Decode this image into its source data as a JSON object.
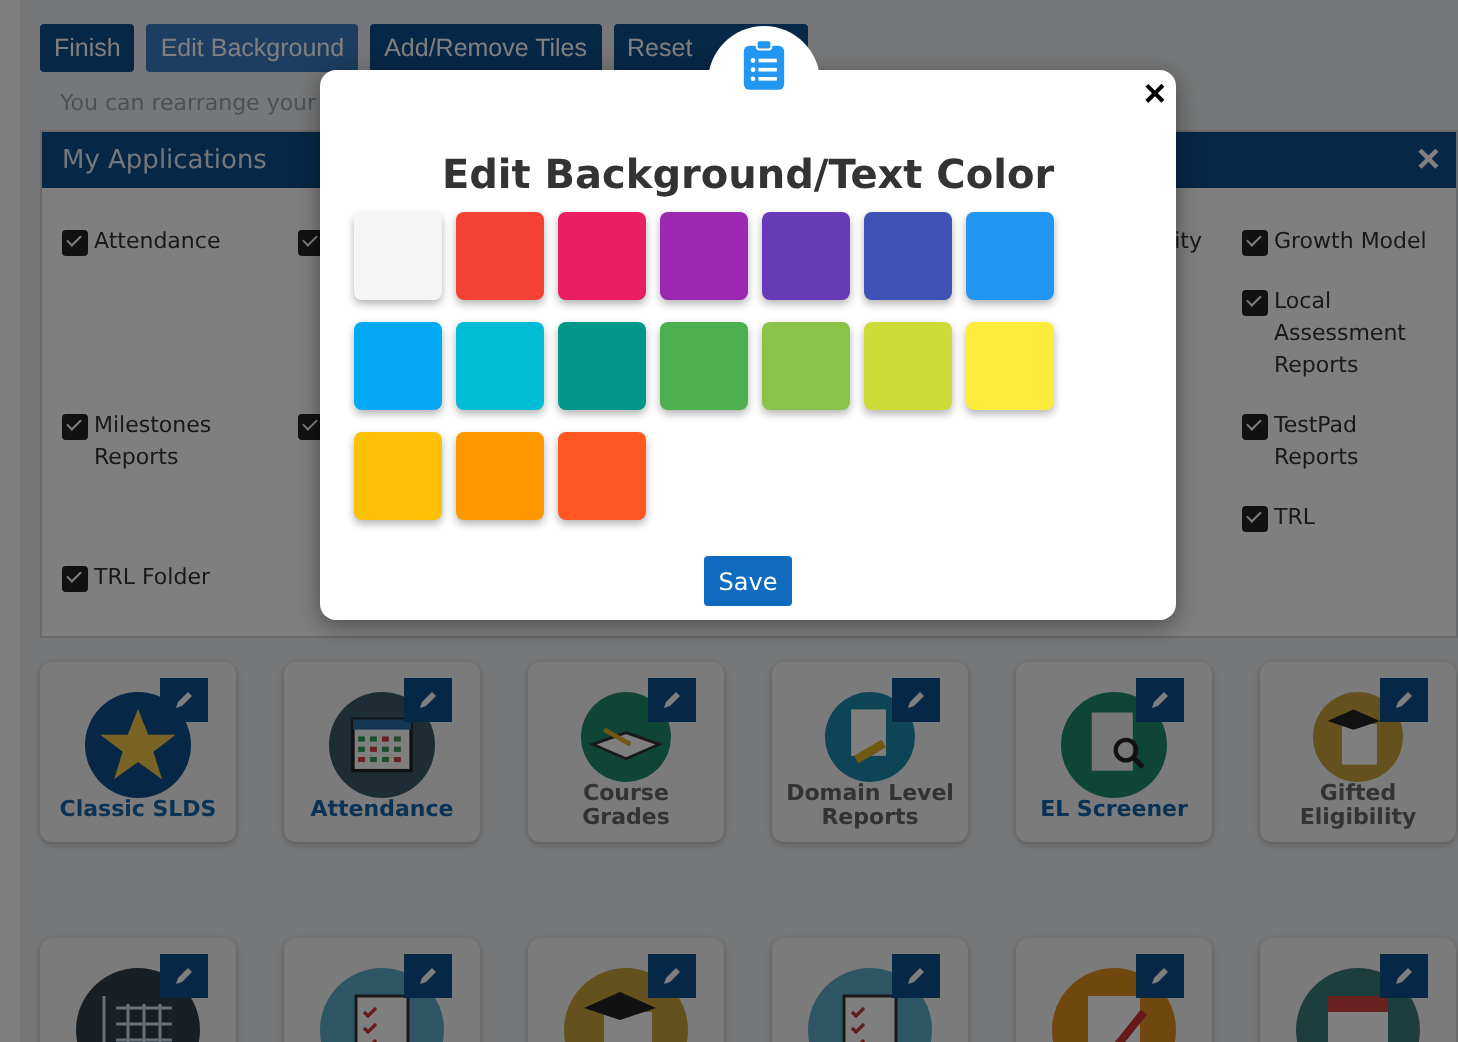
{
  "toolbar": [
    {
      "label": "Finish",
      "selected": false
    },
    {
      "label": "Edit Background",
      "selected": true
    },
    {
      "label": "Add/Remove Tiles",
      "selected": false
    },
    {
      "label": "Reset",
      "selected": false
    }
  ],
  "hint": "You can rearrange your",
  "panel": {
    "title": "My Applications",
    "close": "×",
    "rows": [
      [
        {
          "label": "Attendance",
          "checked": true
        },
        {
          "checked": true
        },
        null,
        null,
        {
          "label": "ity"
        },
        {
          "label": "Growth Model",
          "checked": true
        }
      ],
      [
        null,
        null,
        null,
        null,
        null,
        {
          "label": "Local Assessment Reports",
          "checked": true
        }
      ],
      [
        {
          "label": "Milestones Reports",
          "checked": true
        },
        {
          "checked": true
        },
        null,
        null,
        null,
        {
          "label": "TestPad Reports",
          "checked": true
        }
      ],
      [
        null,
        null,
        null,
        null,
        null,
        {
          "label": "TRL",
          "checked": true
        }
      ],
      [
        {
          "label": "TRL Folder",
          "checked": true
        },
        null,
        null,
        null,
        null,
        null
      ]
    ]
  },
  "tiles": [
    {
      "title": "Classic SLDS",
      "linked": true,
      "kind": "star"
    },
    {
      "title": "Attendance",
      "linked": true,
      "kind": "calendar"
    },
    {
      "title": "Course Grades",
      "linked": false,
      "kind": "book"
    },
    {
      "title": "Domain Level Reports",
      "linked": false,
      "kind": "clipboard"
    },
    {
      "title": "EL Screener",
      "linked": true,
      "kind": "search-doc"
    },
    {
      "title": "Gifted Eligibility",
      "linked": false,
      "kind": "cap"
    },
    {
      "kind": "chart"
    },
    {
      "kind": "checklist"
    },
    {
      "kind": "cap"
    },
    {
      "kind": "checklist"
    },
    {
      "kind": "pen"
    },
    {
      "kind": "date"
    }
  ],
  "modal": {
    "title": "Edit Background/Text Color",
    "close": "×",
    "save": "Save",
    "swatches": [
      {
        "color": "#f5f5f5",
        "selected": false
      },
      {
        "color": "#f44336",
        "selected": false
      },
      {
        "color": "#e91e63",
        "selected": false
      },
      {
        "color": "#9c27b0",
        "selected": false
      },
      {
        "color": "#673ab7",
        "selected": false
      },
      {
        "color": "#3f51b5",
        "selected": false
      },
      {
        "color": "#2196f3",
        "selected": false
      },
      {
        "color": "#03a9f4",
        "selected": false
      },
      {
        "color": "#00bcd4",
        "selected": false
      },
      {
        "color": "#009688",
        "selected": false
      },
      {
        "color": "#4caf50",
        "selected": false
      },
      {
        "color": "#8bc34a",
        "selected": false
      },
      {
        "color": "#cddc39",
        "selected": false
      },
      {
        "color": "#ffeb3b",
        "selected": false
      },
      {
        "color": "#ffc107",
        "selected": false
      },
      {
        "color": "#ff9800",
        "selected": false
      },
      {
        "color": "#ff5722",
        "selected": false
      }
    ]
  }
}
